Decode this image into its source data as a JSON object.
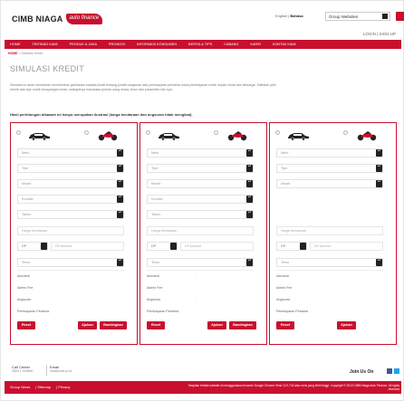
{
  "header": {
    "logo_text": "CIMB NIAGA",
    "logo_badge": "auto finance",
    "lang_en": "English",
    "lang_sep": " | ",
    "lang_id": "Bahasa",
    "group_select": "Group Websites",
    "login": "LOGIN | SIGN UP"
  },
  "nav": {
    "items": [
      "HOME",
      "TENTANG KAMI",
      "PRODUK & JASA",
      "PROMOSI",
      "INFORMASI KONSUMEN",
      "BERITA & TIPS",
      "CABANG",
      "KARIR",
      "KONTAK KAMI"
    ]
  },
  "breadcrumb": {
    "home": "HOME",
    "current": "> Simulasi Kredit"
  },
  "page": {
    "title": "SIMULASI KREDIT",
    "description": "Simulasi ini akan membantu memberikan gambaran kepada Anda tentang jumlah angsuran dan pembayaran pertama untuk pembayaran mobil impian Anda dan keluarga. Silahkan pilih merek dan tipe mobil kesayangan Anda, selanjutnya masukkan jumlah uang muka, tenor dan parameter lain nya.",
    "note": "Hasil perhitungan dibawah ini hanya merupakan ilustrasi (harga kendaraan dan angsuran tidak mengikat)."
  },
  "calculator": {
    "fields": {
      "merk": "Merk",
      "tipe": "Tipe",
      "model": "Model",
      "kondisi": "Kondisi",
      "tahun": "Tahun",
      "harga": "Harga Kendaraan",
      "dp": "DP",
      "dp_amount": "DP Amount",
      "tenor": "Tenor"
    },
    "results": {
      "asuransi": "Asuransi",
      "admin_fee": "Admin Fee",
      "angsuran": "Angsuran",
      "pembayaran_pertama": "Pembayaran Pertama"
    },
    "buttons": {
      "reset": "Reset",
      "ajukan": "Ajukan",
      "bandingkan": "Bandingkan"
    }
  },
  "footer": {
    "call_center_label": "Call Center",
    "call_center_value": "0804 1 000800",
    "email_label": "Email",
    "email_value": "info@cnaf.co.id",
    "join_us": "Join Us On",
    "links": [
      "Group News",
      "Sitemap",
      "Privacy"
    ],
    "note": "Tampilan terbaik website ini menggunakan browser Google Chrome Versi 12.0.742 atau versi yang lebih tinggi. Copyright © 2013 CIMB Niaga Auto Finance. All rights reserved"
  },
  "colors": {
    "brand": "#c8102e"
  }
}
